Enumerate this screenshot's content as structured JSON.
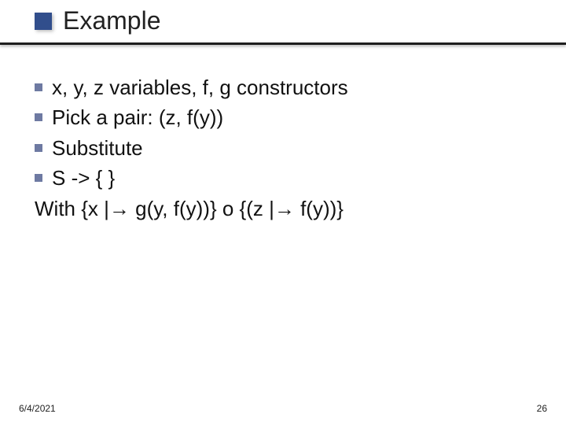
{
  "title": "Example",
  "bullets": [
    "x, y, z variables, f, g constructors",
    "Pick a pair: (z, f(y))",
    "Substitute",
    "S -> { }"
  ],
  "with_line": "With {x |→ g(y, f(y))} o {(z |→ f(y))}",
  "footer": {
    "date": "6/4/2021",
    "page": "26"
  }
}
